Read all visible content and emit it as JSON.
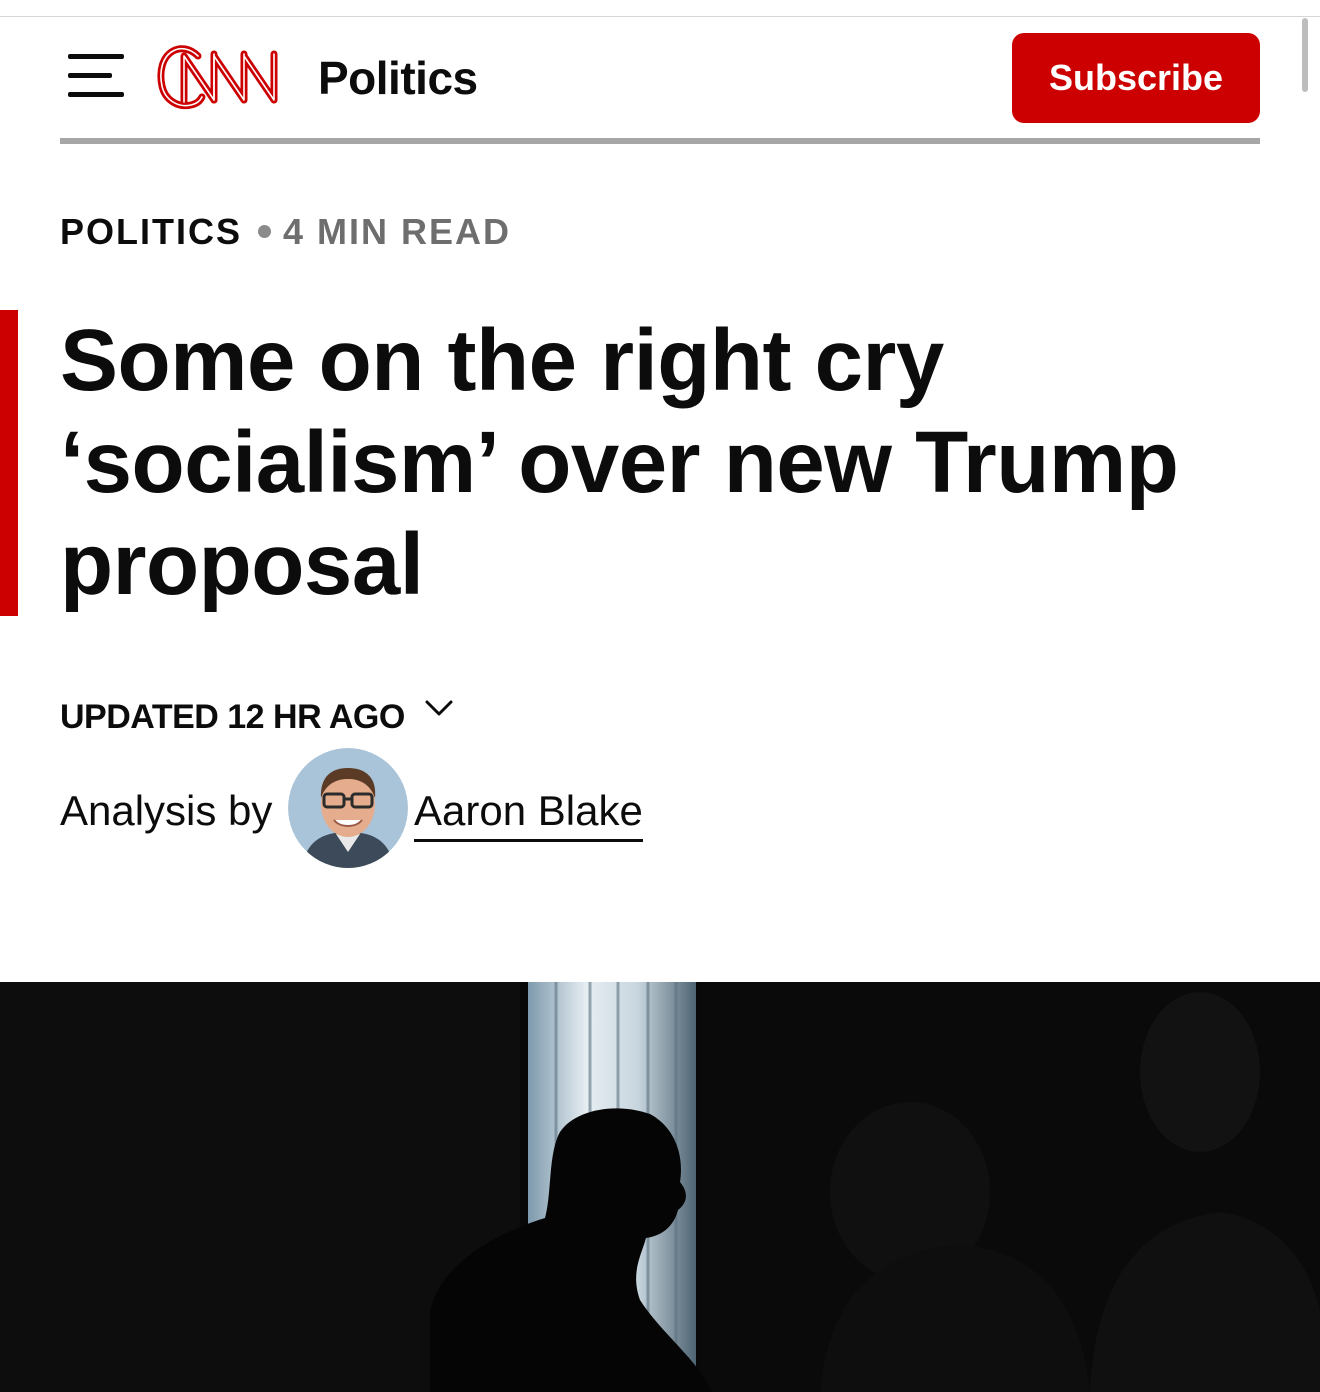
{
  "header": {
    "menu_icon": "hamburger-menu-icon",
    "logo_text": "CNN",
    "section_title": "Politics",
    "subscribe_label": "Subscribe"
  },
  "article": {
    "category": "POLITICS",
    "read_time": "4 MIN READ",
    "headline": "Some on the right cry ‘socialism’ over new Trump proposal",
    "updated": "UPDATED 12 HR AGO",
    "updated_icon": "chevron-down-icon",
    "byline_prefix": "Analysis by",
    "author": "Aaron Blake"
  },
  "colors": {
    "brand_red": "#cc0000",
    "text": "#0c0c0c",
    "muted": "#6e6e6e",
    "rule": "#a6a6a6"
  }
}
